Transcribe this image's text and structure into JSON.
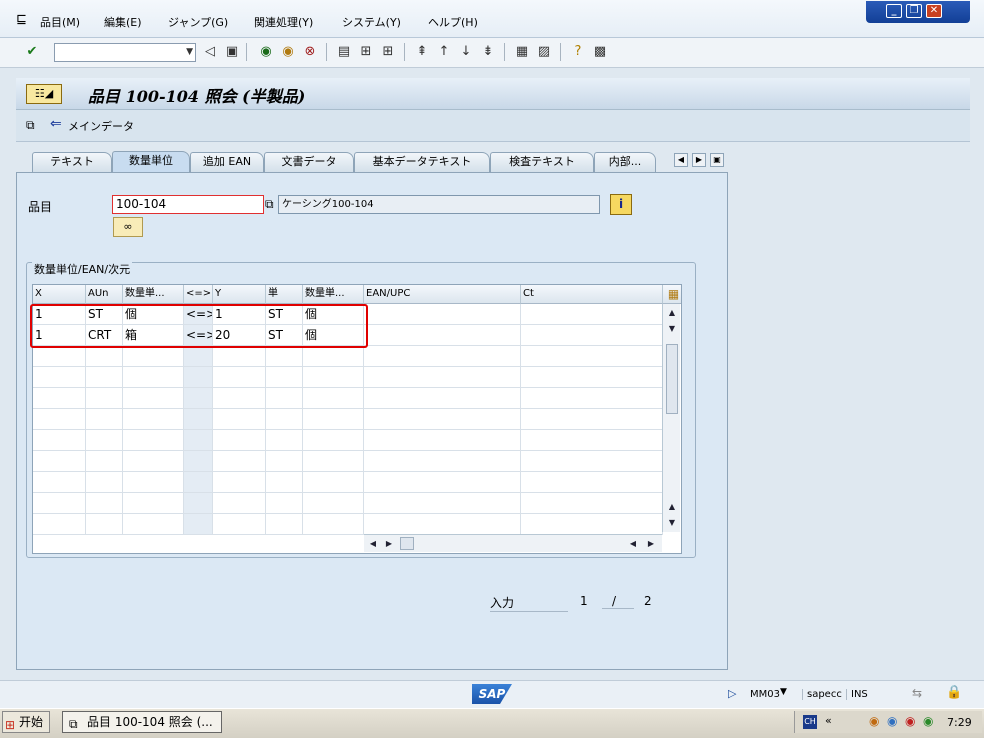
{
  "menubar": {
    "items": [
      "品目(M)",
      "編集(E)",
      "ジャンプ(G)",
      "関連処理(Y)",
      "システム(Y)",
      "ヘルプ(H)"
    ]
  },
  "window_controls": {
    "minimize": "_",
    "restore": "❐",
    "close": "✕"
  },
  "title": "品目 100-104 照会 (半製品)",
  "appbar": {
    "main_data_label": "メインデータ"
  },
  "tabs": [
    "テキスト",
    "数量単位",
    "追加 EAN",
    "文書データ",
    "基本データテキスト",
    "検査テキスト",
    "内部..."
  ],
  "active_tab": "数量単位",
  "material": {
    "label": "品目",
    "value": "100-104",
    "description": "ケーシング100-104"
  },
  "group": {
    "label": "数量単位/EAN/次元"
  },
  "table": {
    "columns": [
      "X",
      "AUn",
      "数量単...",
      "<=>",
      "Y",
      "単",
      "数量単...",
      "EAN/UPC",
      "Ct"
    ],
    "rows": [
      [
        "1",
        "ST",
        "個",
        "<=>",
        "1",
        "ST",
        "個",
        "",
        ""
      ],
      [
        "1",
        "CRT",
        "箱",
        "<=>",
        "20",
        "ST",
        "個",
        "",
        ""
      ]
    ],
    "empty_rows": 9
  },
  "entry": {
    "label": "入力",
    "current": "1",
    "separator": "/",
    "total": "2"
  },
  "statusbar": {
    "logo": "SAP",
    "transaction": "MM03",
    "server": "sapecc",
    "mode": "INS"
  },
  "taskbar": {
    "start_label": "开始",
    "task_label": "品目 100-104 照会 (...",
    "clock": "7:29"
  },
  "colors": {
    "highlight_border": "#e00000",
    "window_blue": "#1a4ea8"
  }
}
